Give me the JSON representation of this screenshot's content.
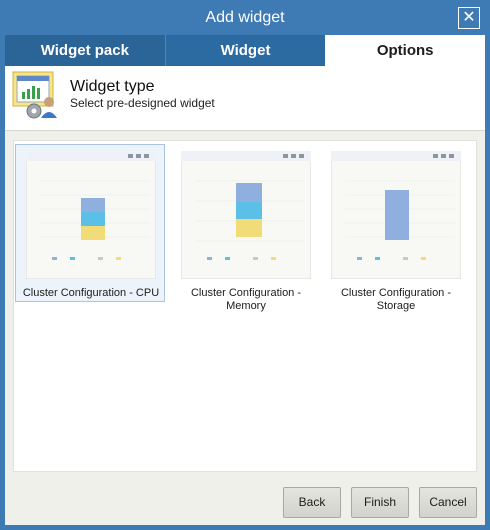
{
  "dialog": {
    "title": "Add widget",
    "close_symbol": "✕"
  },
  "tabs": [
    {
      "label": "Widget pack"
    },
    {
      "label": "Widget"
    },
    {
      "label": "Options"
    }
  ],
  "header": {
    "title": "Widget type",
    "subtitle": "Select pre-designed widget",
    "icon": "widget-type-icon"
  },
  "widgets": [
    {
      "label": "Cluster Configuration - CPU",
      "selected": true
    },
    {
      "label": "Cluster Configuration - Memory",
      "selected": false
    },
    {
      "label": "Cluster Configuration - Storage",
      "selected": false
    }
  ],
  "buttons": {
    "back": "Back",
    "finish": "Finish",
    "cancel": "Cancel"
  },
  "colors": {
    "titlebar": "#3e7ab3",
    "tab_dark": "#2b6497",
    "series_blue": "#8fb0de",
    "series_cyan": "#5bbfe8",
    "series_yellow": "#f2dc78"
  }
}
